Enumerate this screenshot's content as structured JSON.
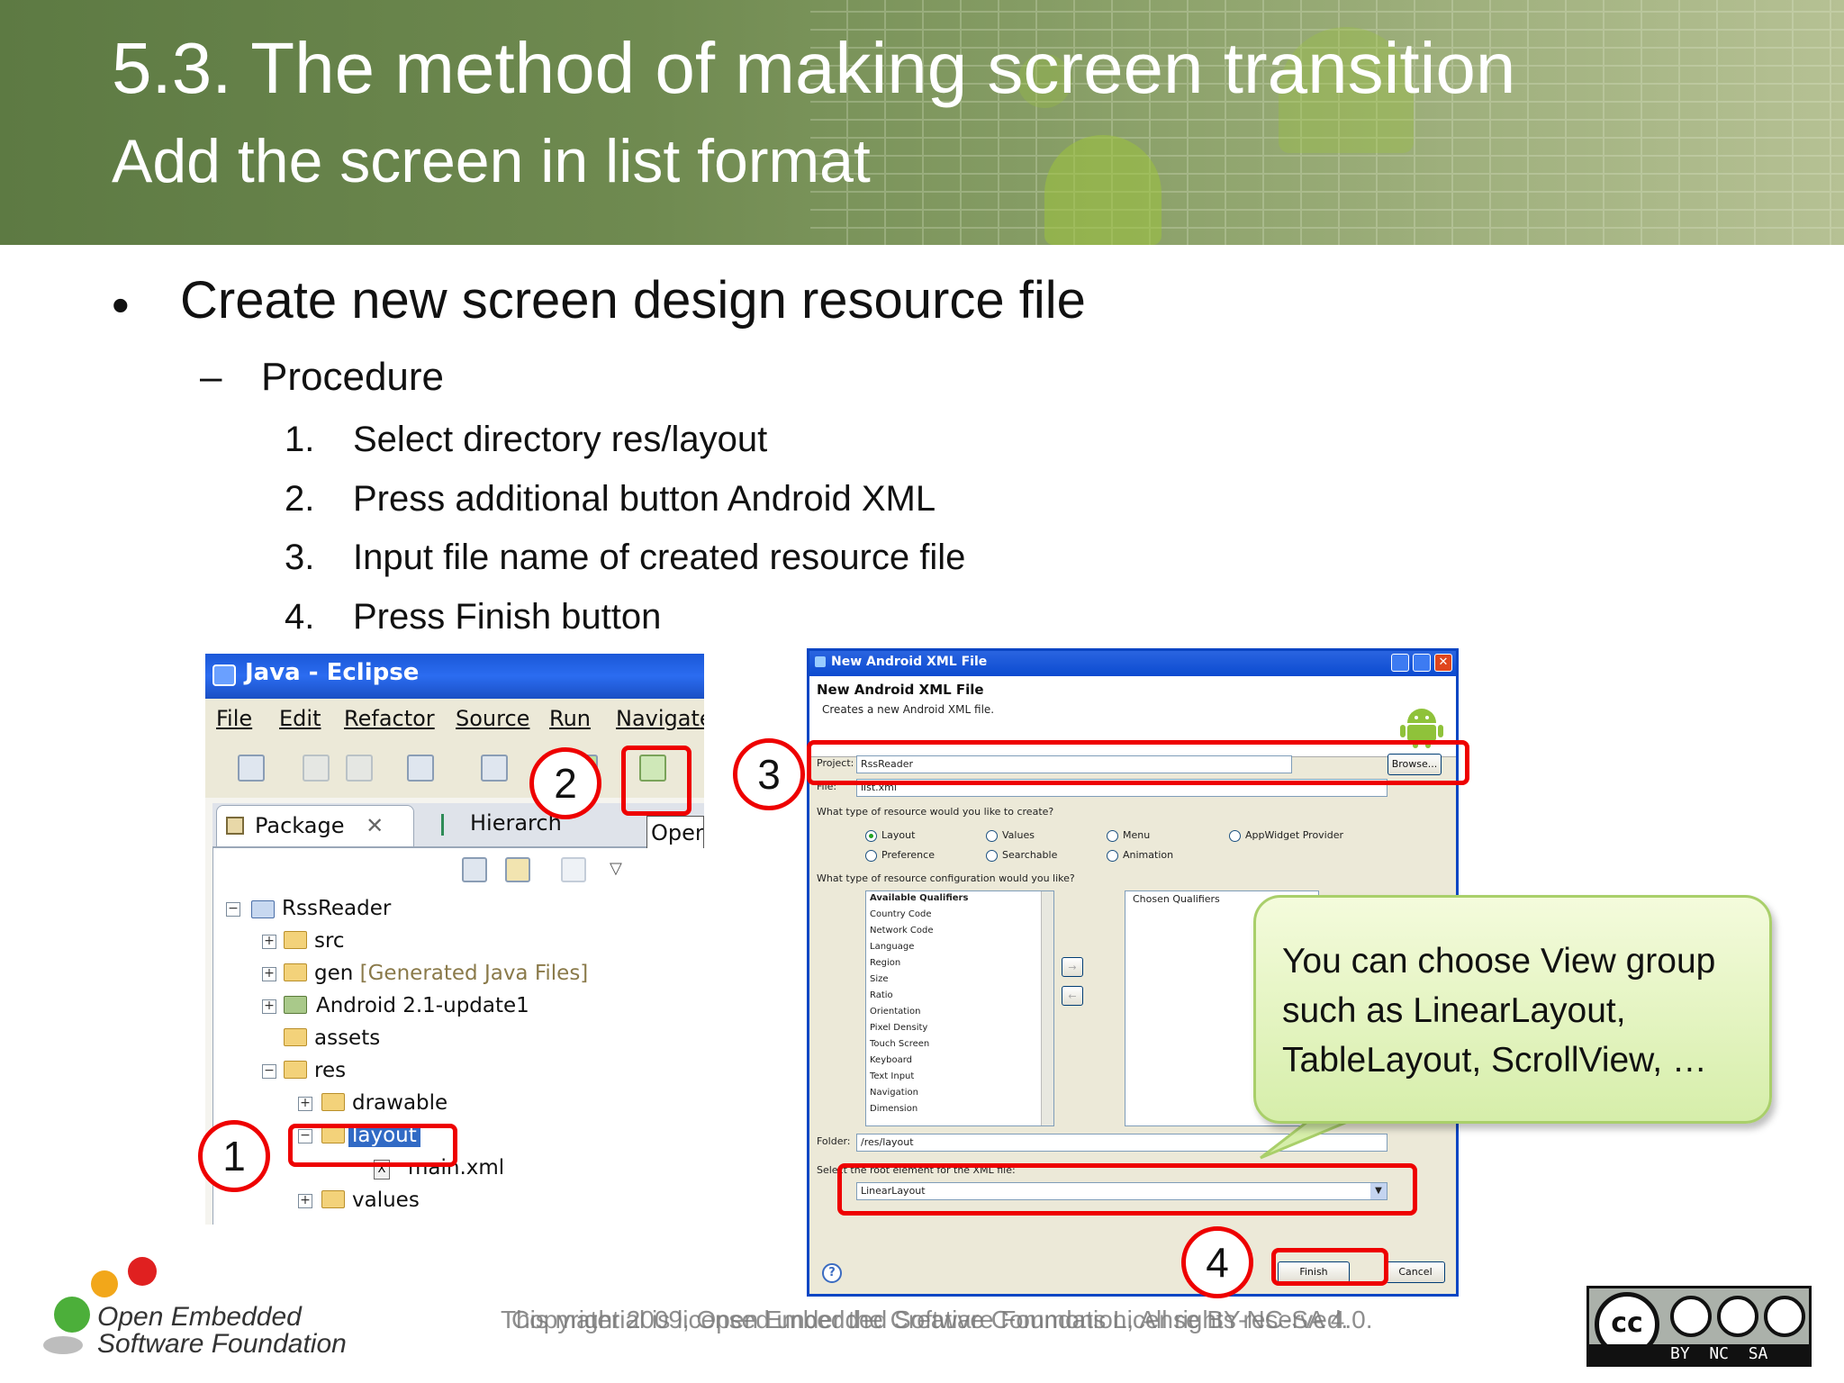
{
  "slide": {
    "title": "5.3. The method of making screen transition",
    "subtitle": "Add the screen in list format",
    "bullet": "Create new screen design resource file",
    "sub_bullet": "Procedure",
    "steps": [
      {
        "num": "1.",
        "text": "Select directory res/layout"
      },
      {
        "num": "2.",
        "text": "Press additional button Android XML"
      },
      {
        "num": "3.",
        "text": "Input file name of created resource file"
      },
      {
        "num": "4.",
        "text": "Press Finish button"
      }
    ]
  },
  "eclipse": {
    "title": "Java - Eclipse",
    "menu": [
      "File",
      "Edit",
      "Refactor",
      "Source",
      "Run",
      "Navigate"
    ],
    "tabs": {
      "package": "Package",
      "hierarchy": "Hierarch"
    },
    "open_partial": "Open:",
    "tree": {
      "project": "RssReader",
      "src": "src",
      "gen": "gen",
      "gen_note": "[Generated Java Files]",
      "android_lib": "Android 2.1-update1",
      "assets": "assets",
      "res": "res",
      "drawable": "drawable",
      "layout": "layout",
      "main_xml": "main.xml",
      "values": "values"
    }
  },
  "dialog": {
    "title": "New Android XML File",
    "heading": "New Android XML File",
    "description": "Creates a new Android XML file.",
    "project_label": "Project:",
    "project_value": "RssReader",
    "browse_label": "Browse...",
    "file_label": "File:",
    "file_value": "list.xml",
    "type_question": "What type of resource would you like to create?",
    "resource_types": [
      {
        "label": "Layout",
        "selected": true
      },
      {
        "label": "Values",
        "selected": false
      },
      {
        "label": "Menu",
        "selected": false
      },
      {
        "label": "AppWidget Provider",
        "selected": false
      },
      {
        "label": "Preference",
        "selected": false
      },
      {
        "label": "Searchable",
        "selected": false
      },
      {
        "label": "Animation",
        "selected": false
      }
    ],
    "config_question": "What type of resource configuration would you like?",
    "available_header": "Available Qualifiers",
    "chosen_header": "Chosen Qualifiers",
    "qualifiers": [
      "Country Code",
      "Network Code",
      "Language",
      "Region",
      "Size",
      "Ratio",
      "Orientation",
      "Pixel Density",
      "Touch Screen",
      "Keyboard",
      "Text Input",
      "Navigation",
      "Dimension"
    ],
    "folder_label": "Folder:",
    "folder_value": "/res/layout",
    "root_question": "Select the root element for the XML file:",
    "root_value": "LinearLayout",
    "finish_label": "Finish",
    "cancel_label": "Cancel",
    "help_glyph": "?"
  },
  "annotations": {
    "one": "1",
    "two": "2",
    "three": "3",
    "four": "4"
  },
  "callout": {
    "text": "You can choose View group such as LinearLayout, TableLayout, ScrollView, …"
  },
  "footer": {
    "org_line1": "Open Embedded",
    "org_line2": "Software Foundation",
    "copyright": "Copyright 2009, Open Embedded Software Foundation, All rights reserved.",
    "license": "This material is licensed under the Creative Commons License BY-NC-SA 4.0.",
    "cc_badge": {
      "main": "cc",
      "labels": "BY  NC  SA"
    }
  },
  "colors": {
    "header_green": "#6f8a50",
    "annotation_red": "#e00000",
    "callout_green": "#d6eeaa",
    "xp_blue": "#2b6cf0"
  }
}
